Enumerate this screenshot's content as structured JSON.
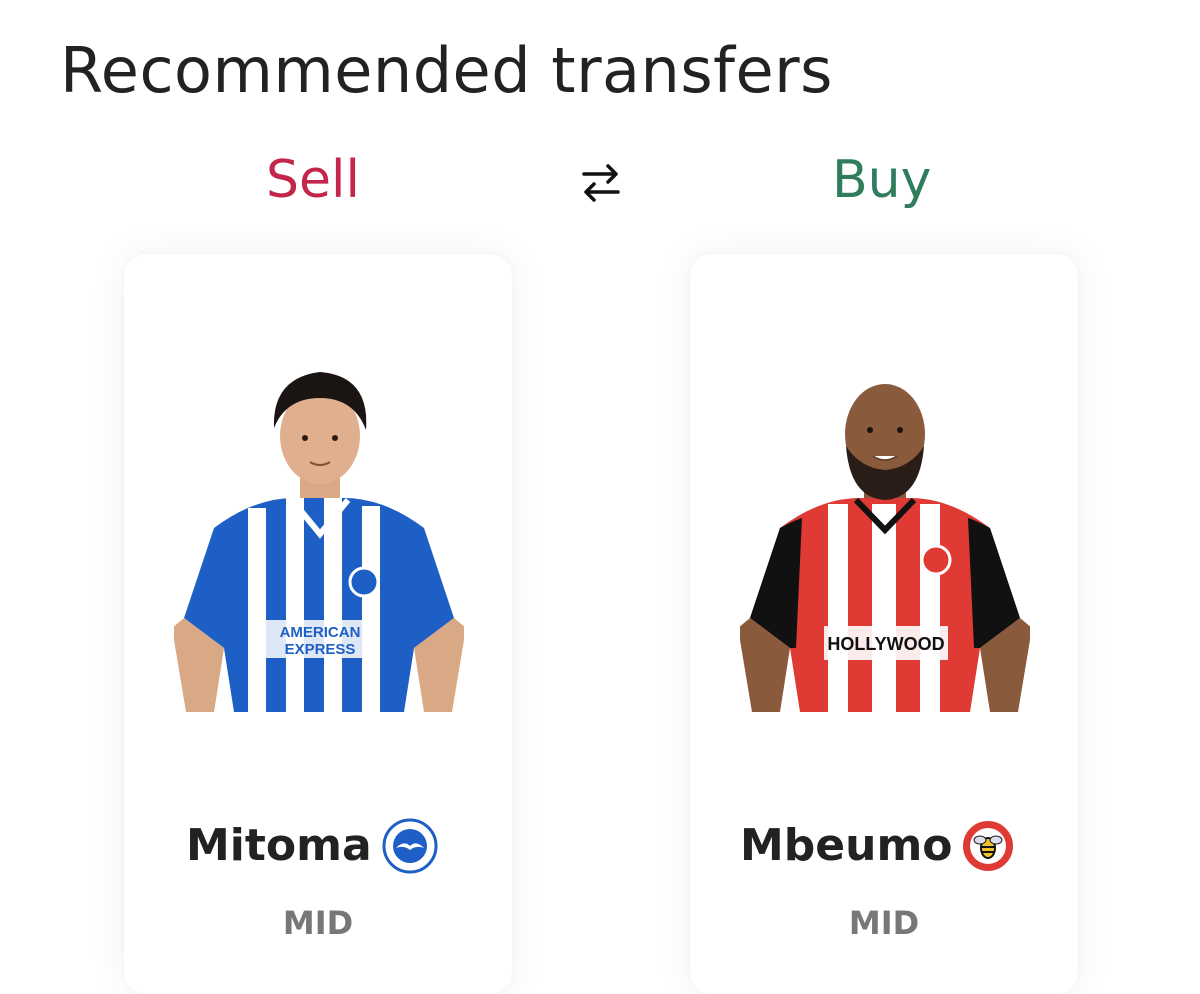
{
  "page": {
    "title": "Recommended transfers"
  },
  "transfer": {
    "sell_label": "Sell",
    "buy_label": "Buy",
    "swap_icon": "swap-arrows-icon",
    "sell_color": "#c2264a",
    "buy_color": "#2f7d5c"
  },
  "sell_player": {
    "name": "Mitoma",
    "position": "MID",
    "club_badge_icon": "brighton-badge-icon",
    "kit": "blue and white stripes"
  },
  "buy_player": {
    "name": "Mbeumo",
    "position": "MID",
    "club_badge_icon": "brentford-badge-icon",
    "kit": "red and white stripes"
  }
}
